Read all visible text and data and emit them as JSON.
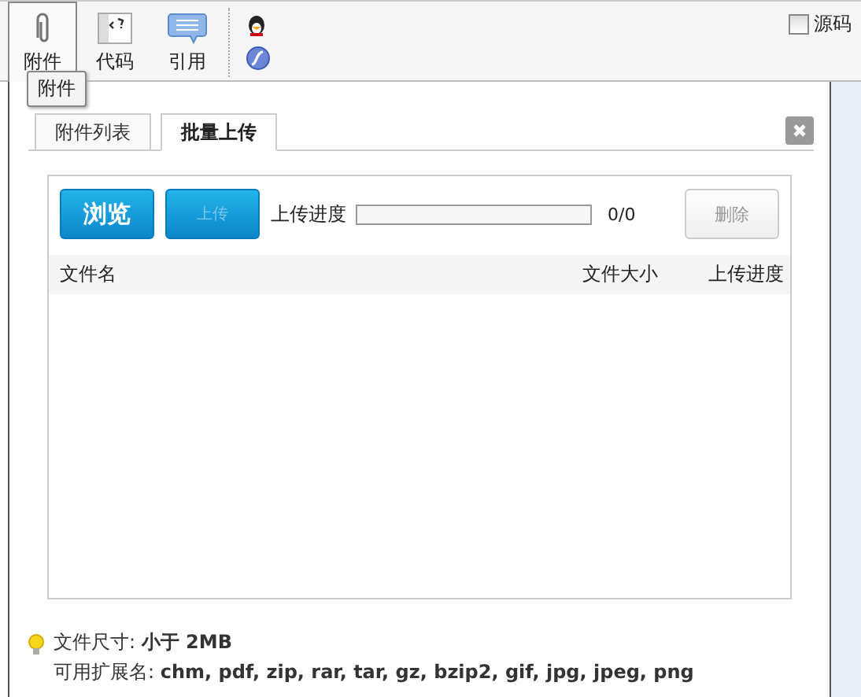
{
  "toolbar": {
    "buttons": [
      {
        "kind": "attach",
        "label": "附件",
        "selected": true
      },
      {
        "kind": "code",
        "label": "代码",
        "selected": false
      },
      {
        "kind": "quote",
        "label": "引用",
        "selected": false
      }
    ],
    "source": {
      "label": "源码",
      "checked": false
    }
  },
  "tooltip": "附件",
  "dialog": {
    "tabs": [
      {
        "label": "附件列表",
        "selected": false
      },
      {
        "label": "批量上传",
        "selected": true
      }
    ],
    "browse": "浏览",
    "upload": {
      "label": "上传",
      "disabled": true
    },
    "progress": {
      "label": "上传进度",
      "level": 0,
      "reading": "0/0"
    },
    "delete": {
      "label": "删除",
      "disabled": true
    },
    "columns": [
      "文件名",
      "文件大小",
      "上传进度"
    ],
    "notes": [
      "文件尺寸: **小于 2MB**",
      "可用扩展名: **chm, pdf, zip, rar, tar, gz, bzip2, gif, jpg, jpeg, png**"
    ]
  }
}
